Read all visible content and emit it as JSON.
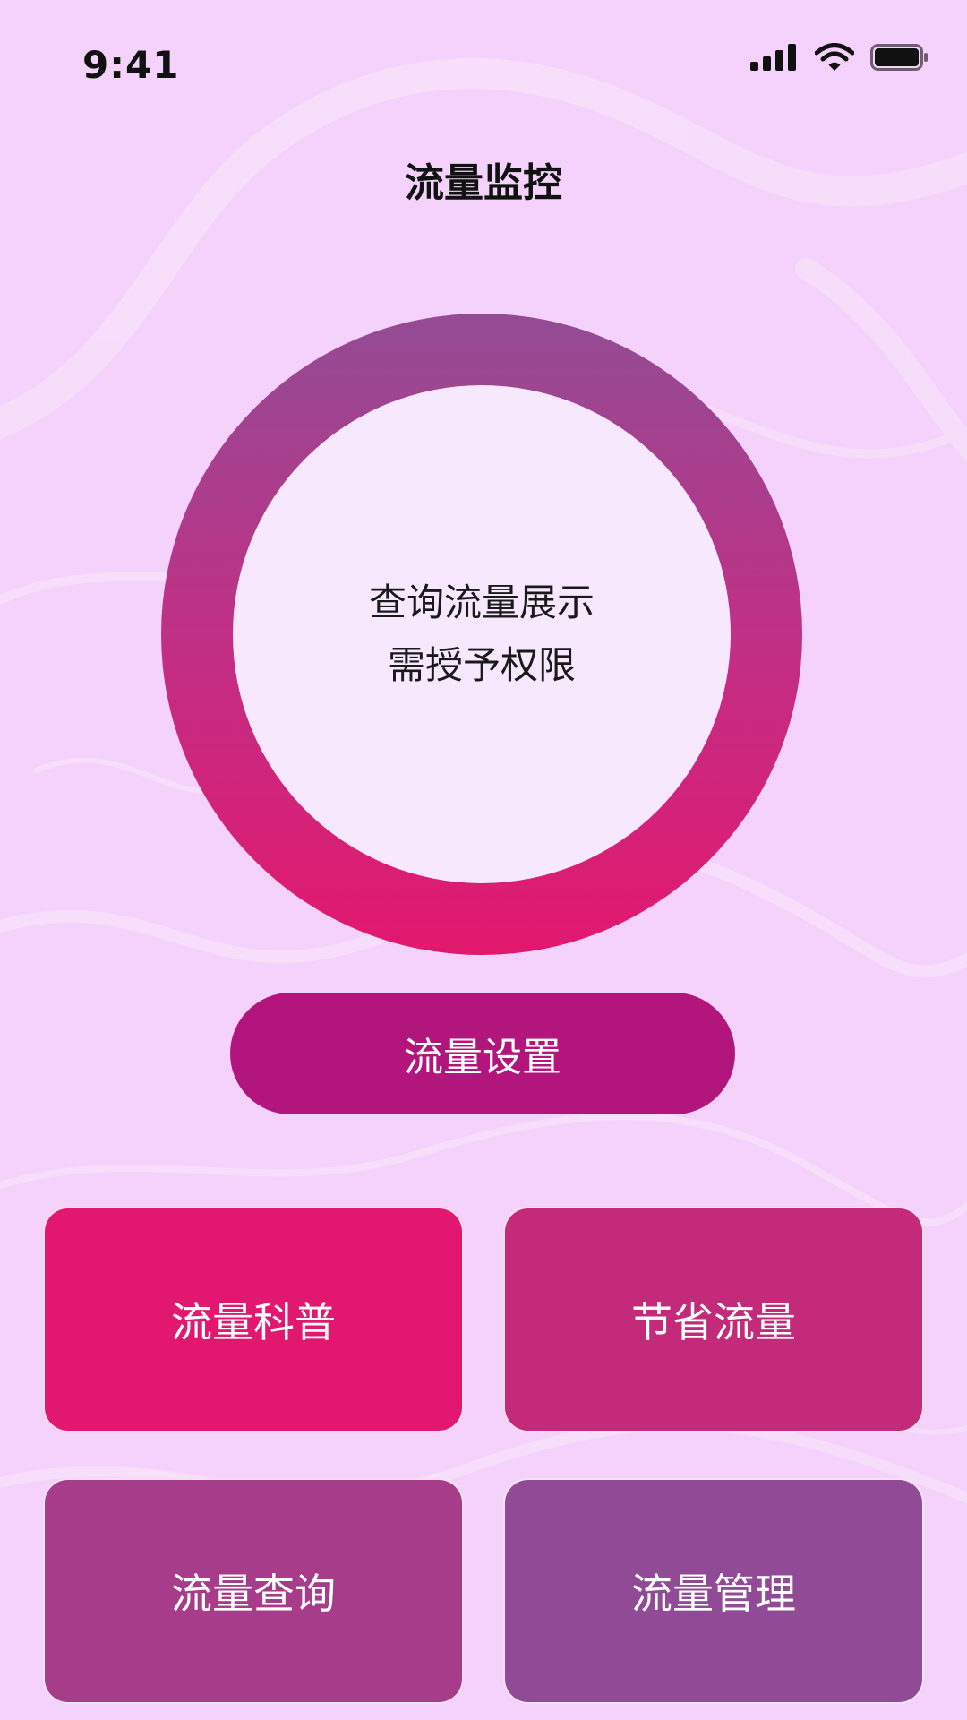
{
  "status_bar": {
    "time": "9:41",
    "icons": [
      "cellular-signal-icon",
      "wifi-icon",
      "battery-icon"
    ]
  },
  "header": {
    "title": "流量监控"
  },
  "usage_ring": {
    "line1": "查询流量展示",
    "line2": "需授予权限"
  },
  "actions": {
    "settings_label": "流量设置"
  },
  "tiles": [
    {
      "label": "流量科普",
      "color": "#e21870"
    },
    {
      "label": "节省流量",
      "color": "#c42a7a"
    },
    {
      "label": "流量查询",
      "color": "#a73c8a"
    },
    {
      "label": "流量管理",
      "color": "#914b96"
    }
  ],
  "colors": {
    "background": "#f4d2fb",
    "ring_top": "#934c94",
    "ring_bottom": "#e2186e",
    "button": "#b2157c"
  }
}
